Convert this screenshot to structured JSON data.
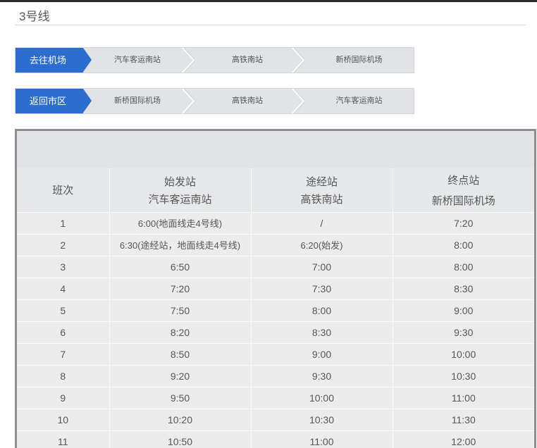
{
  "line": {
    "title": "3号线"
  },
  "routes": [
    {
      "direction": "去往机场",
      "stops": [
        "汽车客运南站",
        "高铁南站",
        "新桥国际机场"
      ]
    },
    {
      "direction": "返回市区",
      "stops": [
        "新桥国际机场",
        "高铁南站",
        "汽车客运南站"
      ]
    }
  ],
  "colors": {
    "accent": "#2d6dd0",
    "routeBar": "#e1e3e6",
    "tableBorder": "#8e8e8e"
  },
  "table": {
    "headers": [
      {
        "label": "班次",
        "sub": ""
      },
      {
        "label": "始发站",
        "sub": "汽车客运南站"
      },
      {
        "label": "途经站",
        "sub": "高铁南站"
      },
      {
        "label": "终点站",
        "sub": "新桥国际机场"
      }
    ],
    "rows": [
      [
        "1",
        "6:00(地面线走4号线)",
        "/",
        "7:20"
      ],
      [
        "2",
        "6:30(途经站，地面线走4号线)",
        "6:20(始发)",
        "8:00"
      ],
      [
        "3",
        "6:50",
        "7:00",
        "8:00"
      ],
      [
        "4",
        "7:20",
        "7:30",
        "8:30"
      ],
      [
        "5",
        "7:50",
        "8:00",
        "9:00"
      ],
      [
        "6",
        "8:20",
        "8:30",
        "9:30"
      ],
      [
        "7",
        "8:50",
        "9:00",
        "10:00"
      ],
      [
        "8",
        "9:20",
        "9:30",
        "10:30"
      ],
      [
        "9",
        "9:50",
        "10:00",
        "11:00"
      ],
      [
        "10",
        "10:20",
        "10:30",
        "11:30"
      ],
      [
        "11",
        "10:50",
        "11:00",
        "12:00"
      ]
    ]
  }
}
